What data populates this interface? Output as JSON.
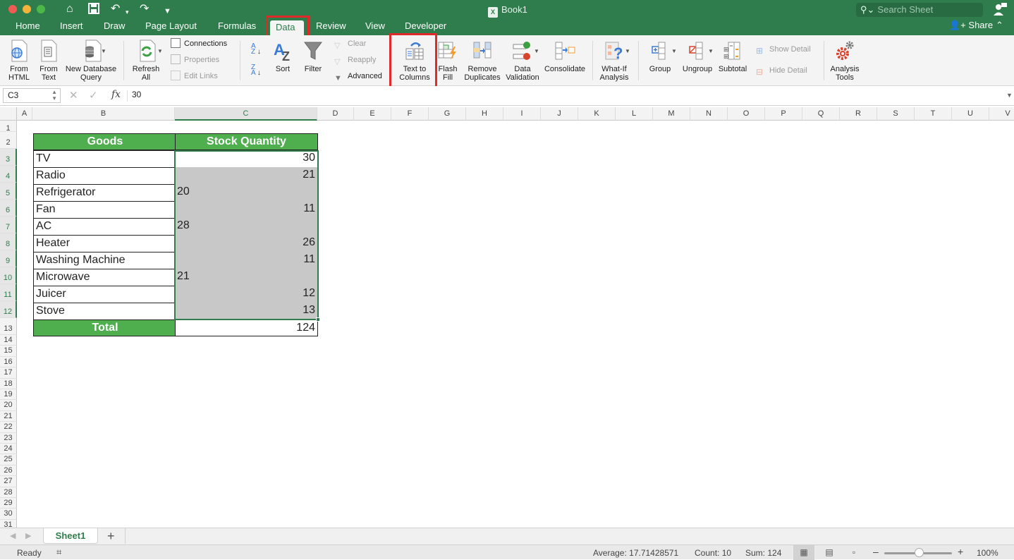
{
  "window": {
    "title": "Book1",
    "search_placeholder": "Search Sheet",
    "share_label": "Share"
  },
  "colors": {
    "brand_green": "#2f7d4d",
    "header_fill": "#4faf4f",
    "selection_fill": "#c8c8c8",
    "highlight_red": "#e02a2a"
  },
  "tabs": [
    "Home",
    "Insert",
    "Draw",
    "Page Layout",
    "Formulas",
    "Data",
    "Review",
    "View",
    "Developer"
  ],
  "active_tab": "Data",
  "ribbon": {
    "from_html": [
      "From",
      "HTML"
    ],
    "from_text": [
      "From",
      "Text"
    ],
    "new_db_query": [
      "New Database",
      "Query"
    ],
    "refresh_all": [
      "Refresh",
      "All"
    ],
    "connections": "Connections",
    "properties": "Properties",
    "edit_links": "Edit Links",
    "sort": "Sort",
    "filter": "Filter",
    "clear": "Clear",
    "reapply": "Reapply",
    "advanced": "Advanced",
    "text_to_columns": [
      "Text to",
      "Columns"
    ],
    "flash_fill": [
      "Flash",
      "Fill"
    ],
    "remove_duplicates": [
      "Remove",
      "Duplicates"
    ],
    "data_validation": [
      "Data",
      "Validation"
    ],
    "consolidate": "Consolidate",
    "what_if": [
      "What-If",
      "Analysis"
    ],
    "group": "Group",
    "ungroup": "Ungroup",
    "subtotal": "Subtotal",
    "show_detail": "Show Detail",
    "hide_detail": "Hide Detail",
    "analysis_tools": [
      "Analysis",
      "Tools"
    ]
  },
  "formula_bar": {
    "name_box": "C3",
    "fx": "fx",
    "value": "30"
  },
  "columns": [
    "A",
    "B",
    "C",
    "D",
    "E",
    "F",
    "G",
    "H",
    "I",
    "J",
    "K",
    "L",
    "M",
    "N",
    "O",
    "P",
    "Q",
    "R",
    "S",
    "T",
    "U",
    "V"
  ],
  "rows": [
    "1",
    "2",
    "3",
    "4",
    "5",
    "6",
    "7",
    "8",
    "9",
    "10",
    "11",
    "12",
    "13",
    "14",
    "15",
    "16",
    "17",
    "18",
    "19",
    "20",
    "21",
    "22",
    "23",
    "24",
    "25",
    "26",
    "27",
    "28",
    "29",
    "30",
    "31"
  ],
  "table": {
    "headers": [
      "Goods",
      "Stock Quantity"
    ],
    "rows": [
      {
        "good": "TV",
        "qty": "30",
        "align": "right"
      },
      {
        "good": "Radio",
        "qty": "21",
        "align": "right"
      },
      {
        "good": "Refrigerator",
        "qty": "20",
        "align": "left"
      },
      {
        "good": "Fan",
        "qty": "11",
        "align": "right"
      },
      {
        "good": "AC",
        "qty": "28",
        "align": "left"
      },
      {
        "good": "Heater",
        "qty": "26",
        "align": "right"
      },
      {
        "good": "Washing Machine",
        "qty": "11",
        "align": "right"
      },
      {
        "good": "Microwave",
        "qty": "21",
        "align": "left"
      },
      {
        "good": "Juicer",
        "qty": "12",
        "align": "right"
      },
      {
        "good": "Stove",
        "qty": "13",
        "align": "right"
      }
    ],
    "total_label": "Total",
    "total_value": "124"
  },
  "sheets": [
    "Sheet1"
  ],
  "status": {
    "ready": "Ready",
    "average": "Average: 17.71428571",
    "count": "Count: 10",
    "sum": "Sum: 124",
    "zoom": "100%",
    "zoom_percent": 100
  }
}
